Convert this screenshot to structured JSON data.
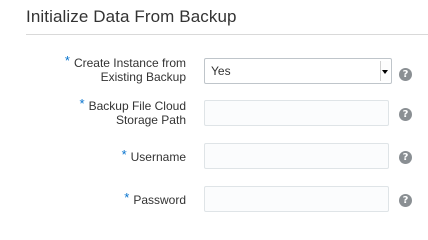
{
  "section": {
    "title": "Initialize Data From Backup"
  },
  "fields": [
    {
      "label_line1": "Create Instance from",
      "label_line2": "Existing Backup",
      "required_marker": "*",
      "type": "select",
      "value": "Yes",
      "help_icon": "help-circle-icon",
      "help_glyph": "?"
    },
    {
      "label_line1": "Backup File Cloud",
      "label_line2": "Storage Path",
      "required_marker": "*",
      "type": "text",
      "value": "",
      "help_icon": "help-circle-icon",
      "help_glyph": "?"
    },
    {
      "label_line1": "Username",
      "required_marker": "*",
      "type": "text",
      "value": "",
      "help_icon": "help-circle-icon",
      "help_glyph": "?"
    },
    {
      "label_line1": "Password",
      "required_marker": "*",
      "type": "password",
      "value": "",
      "help_icon": "help-circle-icon",
      "help_glyph": "?"
    }
  ],
  "colors": {
    "required_marker": "#0572ce",
    "help_icon_bg": "#8a8f93",
    "input_border": "#dfe4e7",
    "text": "#333333"
  }
}
